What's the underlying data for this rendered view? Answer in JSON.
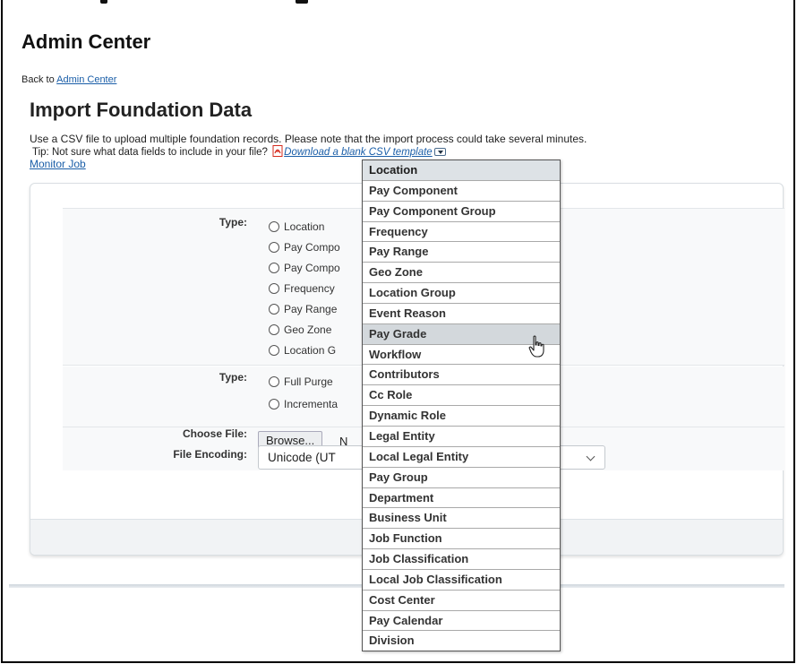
{
  "header": {
    "title": "Admin Center",
    "back_prefix": "Back to ",
    "back_link": "Admin Center"
  },
  "page": {
    "title": "Import Foundation Data",
    "description": "Use a CSV file to upload multiple foundation records. Please note that the import process could take several minutes.",
    "tip_prefix": "Tip: Not sure what data fields to include in your file?",
    "tip_link": "Download a blank CSV template",
    "monitor_link": "Monitor Job"
  },
  "form": {
    "type_label": "Type:",
    "type_options": [
      "Location",
      "Pay Compo",
      "Pay Compo",
      "Frequency",
      "Pay Range",
      "Geo Zone",
      "Location G"
    ],
    "purge_label": "Type:",
    "purge_options": [
      "Full Purge",
      "Incrementa"
    ],
    "file_label": "Choose File:",
    "browse_label": "Browse...",
    "browse_after": "N",
    "encoding_label": "File Encoding:",
    "encoding_value": "Unicode (UT"
  },
  "dropdown": {
    "selected": "Location",
    "hovered": "Pay Grade",
    "options": [
      "Location",
      "Pay Component",
      "Pay Component Group",
      "Frequency",
      "Pay Range",
      "Geo Zone",
      "Location Group",
      "Event Reason",
      "Pay Grade",
      "Workflow",
      "Contributors",
      "Cc Role",
      "Dynamic Role",
      "Legal Entity",
      "Local Legal Entity",
      "Pay Group",
      "Department",
      "Business Unit",
      "Job Function",
      "Job Classification",
      "Local Job Classification",
      "Cost Center",
      "Pay Calendar",
      "Division"
    ]
  },
  "colors": {
    "link": "#1a5ea8",
    "selected_bg": "#dde2e6",
    "hover_bg": "#d3d8dc",
    "pdf_red": "#d52b1e"
  }
}
